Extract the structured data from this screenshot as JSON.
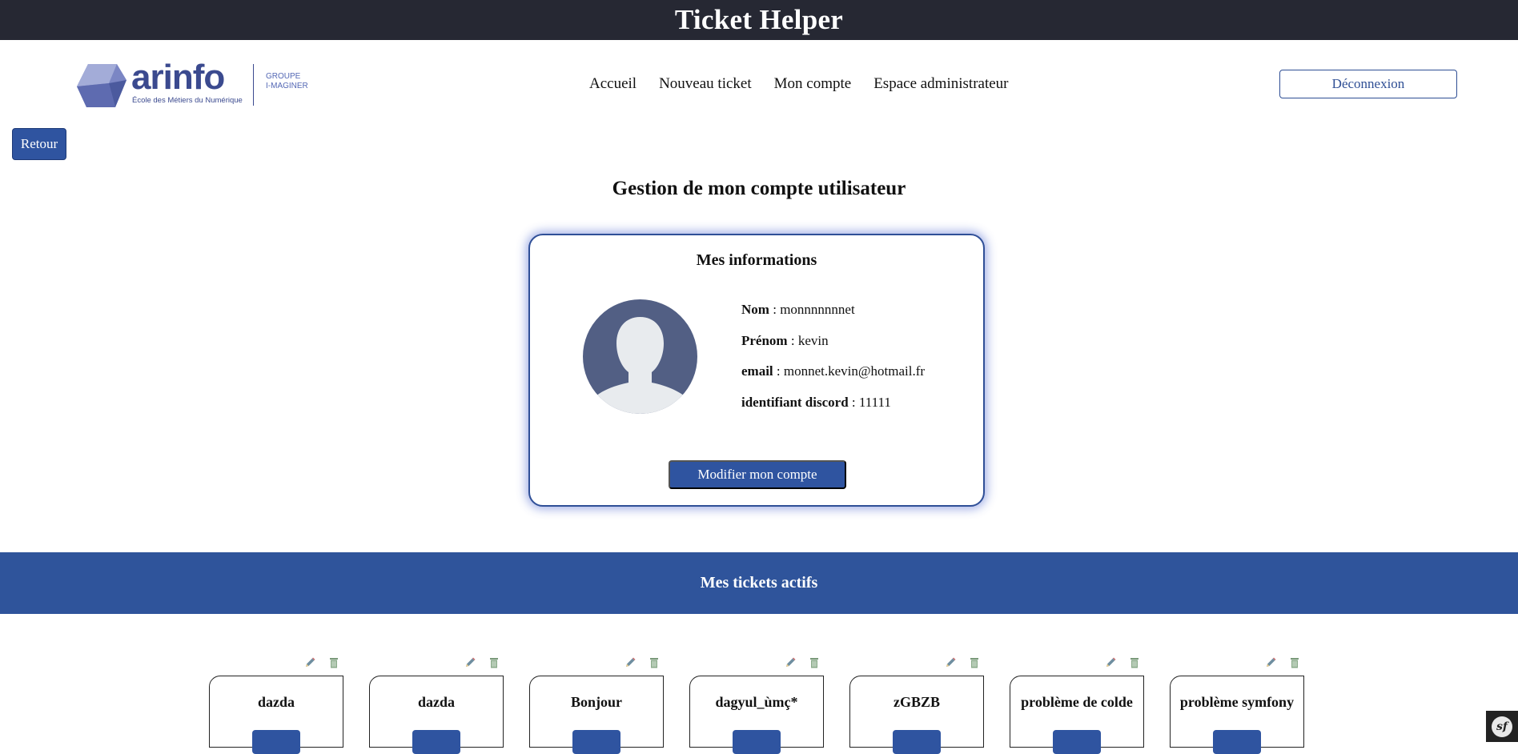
{
  "app_title": "Ticket Helper",
  "logo": {
    "word": "arinfo",
    "tagline": "École des Métiers du Numérique",
    "group_line1": "GROUPE",
    "group_line2": "I-MAGINER"
  },
  "nav": {
    "items": [
      {
        "label": "Accueil"
      },
      {
        "label": "Nouveau ticket"
      },
      {
        "label": "Mon compte"
      },
      {
        "label": "Espace administrateur"
      }
    ],
    "logout_label": "Déconnexion"
  },
  "back_label": "Retour",
  "page_title": "Gestion de mon compte utilisateur",
  "account": {
    "title": "Mes informations",
    "fields": [
      {
        "label": "Nom",
        "value": "monnnnnnnet"
      },
      {
        "label": "Prénom",
        "value": "kevin"
      },
      {
        "label": "email",
        "value": "monnet.kevin@hotmail.fr"
      },
      {
        "label": "identifiant discord",
        "value": "11111"
      }
    ],
    "edit_label": "Modifier mon compte"
  },
  "tickets_section": {
    "title": "Mes tickets actifs",
    "tickets": [
      {
        "title": "dazda"
      },
      {
        "title": "dazda"
      },
      {
        "title": "Bonjour"
      },
      {
        "title": "dagyul_ùmç*"
      },
      {
        "title": "zGBZB"
      },
      {
        "title": "problème de colde"
      },
      {
        "title": "problème symfony"
      }
    ]
  },
  "colors": {
    "topbar": "#262833",
    "primary": "#2f54a0",
    "band": "#2f549b",
    "avatar": "#525f84"
  },
  "icons": [
    "pencil-icon",
    "trash-icon",
    "symfony-icon",
    "user-avatar-icon"
  ]
}
